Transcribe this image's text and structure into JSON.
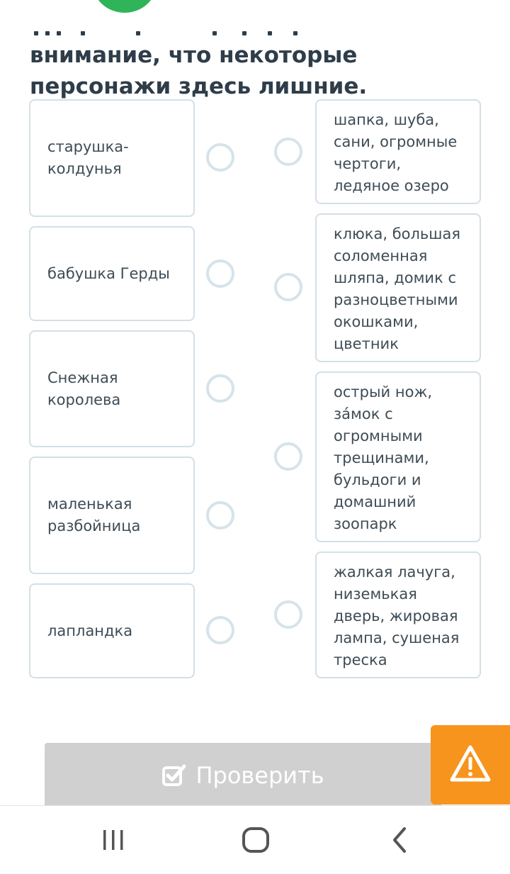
{
  "question": {
    "line1": "внимание, что некоторые",
    "line2": "персонажи здесь лишние."
  },
  "left_items": [
    {
      "label": "старушка-\nколдунья"
    },
    {
      "label": "бабушка Герды"
    },
    {
      "label": "Снежная\nкоролева"
    },
    {
      "label": "маленькая\nразбойница"
    },
    {
      "label": "лапландка"
    }
  ],
  "right_items": [
    {
      "label": "шапка, шуба,\nсани, огромные\nчертоги,\nледяное озеро"
    },
    {
      "label": "клюка, большая\nсоломенная\nшляпа, домик с\nразноцветными\nокошками,\nцветник"
    },
    {
      "label": "острый нож,\nза́мок с\nогромными\nтрещинами,\nбульдоги и\nдомашний\nзоопарк"
    },
    {
      "label": "жалкая лачуга,\nниземькая\nдверь, жировая\nлампа, сушеная\nтреска"
    }
  ],
  "buttons": {
    "check_label": "Проверить",
    "check_icon": "checkbox-icon",
    "warning_icon": "warning-icon"
  },
  "navigation": {
    "recent_icon": "recent-apps-icon",
    "home_icon": "home-icon",
    "back_icon": "back-icon"
  },
  "colors": {
    "accent_green": "#2fb45a",
    "warning_orange": "#f7941d",
    "button_disabled": "#d0d0d0",
    "card_border": "#d4dfe6"
  }
}
